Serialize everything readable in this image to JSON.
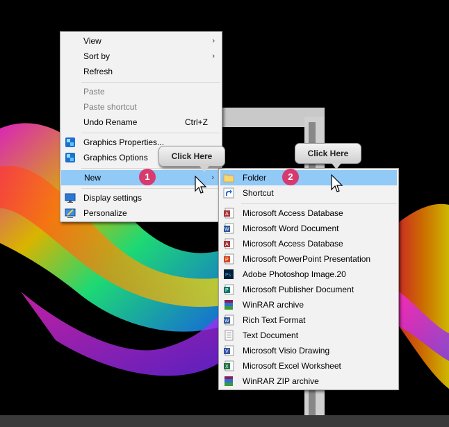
{
  "context_menu": {
    "items": [
      {
        "label": "View",
        "arrow": "›"
      },
      {
        "label": "Sort by",
        "arrow": "›"
      },
      {
        "label": "Refresh"
      },
      {
        "label": "Paste"
      },
      {
        "label": "Paste shortcut"
      },
      {
        "label": "Undo Rename",
        "shortcut": "Ctrl+Z"
      },
      {
        "label": "Graphics Properties...",
        "icon": "intel-graphics-icon"
      },
      {
        "label": "Graphics Options",
        "icon": "intel-graphics-icon"
      },
      {
        "label": "New",
        "arrow": "›"
      },
      {
        "label": "Display settings",
        "icon": "display-icon"
      },
      {
        "label": "Personalize",
        "icon": "personalize-icon"
      }
    ]
  },
  "new_submenu": {
    "items": [
      {
        "label": "Folder",
        "icon": "folder-icon"
      },
      {
        "label": "Shortcut",
        "icon": "shortcut-icon"
      },
      {
        "label": "Microsoft Access Database",
        "icon": "access-icon"
      },
      {
        "label": "Microsoft Word Document",
        "icon": "word-icon"
      },
      {
        "label": "Microsoft Access Database",
        "icon": "access-icon"
      },
      {
        "label": "Microsoft PowerPoint Presentation",
        "icon": "powerpoint-icon"
      },
      {
        "label": "Adobe Photoshop Image.20",
        "icon": "photoshop-icon"
      },
      {
        "label": "Microsoft Publisher Document",
        "icon": "publisher-icon"
      },
      {
        "label": "WinRAR archive",
        "icon": "winrar-icon"
      },
      {
        "label": "Rich Text Format",
        "icon": "rtf-icon"
      },
      {
        "label": "Text Document",
        "icon": "text-icon"
      },
      {
        "label": "Microsoft Visio Drawing",
        "icon": "visio-icon"
      },
      {
        "label": "Microsoft Excel Worksheet",
        "icon": "excel-icon"
      },
      {
        "label": "WinRAR ZIP archive",
        "icon": "winrar-zip-icon"
      }
    ]
  },
  "callouts": [
    {
      "text": "Click Here",
      "badge": "1"
    },
    {
      "text": "Click Here",
      "badge": "2"
    }
  ],
  "colors": {
    "highlight": "#91c9f7",
    "menu_background": "#f2f2f2",
    "badge": "#d63a6e",
    "desktop": "#000000"
  }
}
